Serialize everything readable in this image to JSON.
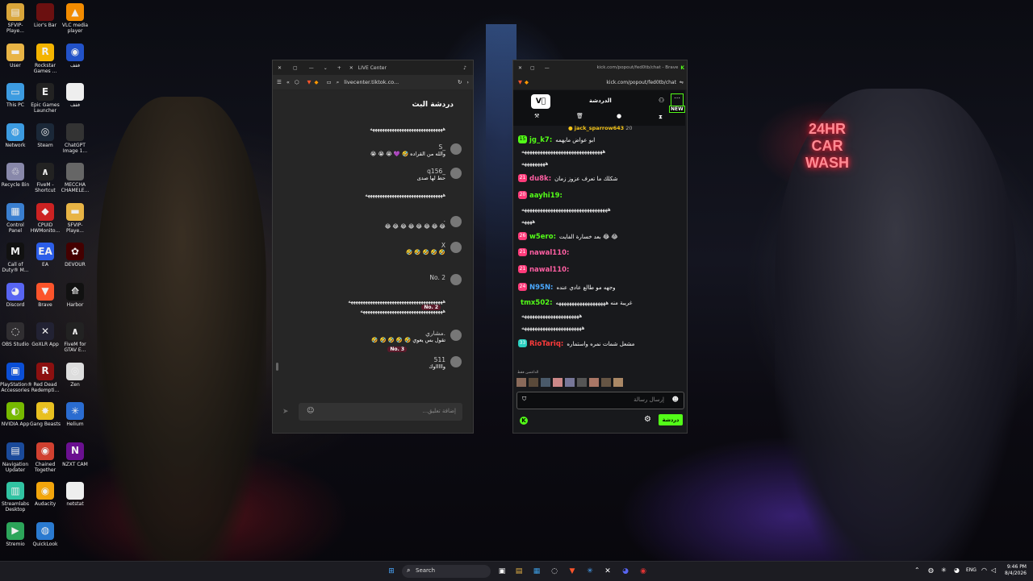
{
  "desktop_icons": [
    {
      "label": "SFVIP-Playe...",
      "color": "#d9a53a",
      "glyph": "▤"
    },
    {
      "label": "Lior's Bar",
      "color": "#6b1010",
      "glyph": ""
    },
    {
      "label": "VLC media player",
      "color": "#f28b00",
      "glyph": "▲"
    },
    {
      "label": "User",
      "color": "#e8b445",
      "glyph": "▬"
    },
    {
      "label": "Rockstar Games ...",
      "color": "#f4b400",
      "glyph": "R"
    },
    {
      "label": "ففف",
      "color": "#2252c8",
      "glyph": "◉"
    },
    {
      "label": "This PC",
      "color": "#3c9be0",
      "glyph": "▭"
    },
    {
      "label": "Epic Games Launcher",
      "color": "#222",
      "glyph": "E"
    },
    {
      "label": "ففف",
      "color": "#eee",
      "glyph": "▶"
    },
    {
      "label": "Network",
      "color": "#3c9be0",
      "glyph": "◍"
    },
    {
      "label": "Steam",
      "color": "#1b2838",
      "glyph": "◎"
    },
    {
      "label": "ChatGPT Image 1...",
      "color": "#333",
      "glyph": ""
    },
    {
      "label": "Recycle Bin",
      "color": "#88a",
      "glyph": "♲"
    },
    {
      "label": "FiveM - Shortcut",
      "color": "#222",
      "glyph": "∧"
    },
    {
      "label": "MECCHA CHAMELE...",
      "color": "#666",
      "glyph": ""
    },
    {
      "label": "Control Panel",
      "color": "#3a7fd0",
      "glyph": "▦"
    },
    {
      "label": "CPUID HWMonito...",
      "color": "#c22",
      "glyph": "◆"
    },
    {
      "label": "SFVIP-Playe...",
      "color": "#e8b445",
      "glyph": "▬"
    },
    {
      "label": "Call of Duty® M...",
      "color": "#111",
      "glyph": "M"
    },
    {
      "label": "EA",
      "color": "#2c5ee8",
      "glyph": "EA"
    },
    {
      "label": "DEVOUR",
      "color": "#400",
      "glyph": "✿"
    },
    {
      "label": "Discord",
      "color": "#5865f2",
      "glyph": "◕"
    },
    {
      "label": "Brave",
      "color": "#fb542b",
      "glyph": "▼"
    },
    {
      "label": "Harbor",
      "color": "#111",
      "glyph": "⟰"
    },
    {
      "label": "OBS Studio",
      "color": "#302e31",
      "glyph": "◌"
    },
    {
      "label": "GoXLR App",
      "color": "#223",
      "glyph": "✕"
    },
    {
      "label": "FiveM for GTAV E...",
      "color": "#222",
      "glyph": "∧"
    },
    {
      "label": "PlayStation® Accessories",
      "color": "#0b4fd6",
      "glyph": "▣"
    },
    {
      "label": "Red Dead Redempti...",
      "color": "#8c1010",
      "glyph": "R"
    },
    {
      "label": "Zen",
      "color": "#ddd",
      "glyph": "◎"
    },
    {
      "label": "NVIDIA App",
      "color": "#76b900",
      "glyph": "◐"
    },
    {
      "label": "Gang Beasts",
      "color": "#e8c020",
      "glyph": "✸"
    },
    {
      "label": "Helium",
      "color": "#2a6cd0",
      "glyph": "✳"
    },
    {
      "label": "Navigation Updater",
      "color": "#1a4a9a",
      "glyph": "▤"
    },
    {
      "label": "Chained Together",
      "color": "#d04030",
      "glyph": "◉"
    },
    {
      "label": "NZXT CAM",
      "color": "#6a1090",
      "glyph": "N"
    },
    {
      "label": "Streamlabs Desktop",
      "color": "#31c3a2",
      "glyph": "▥"
    },
    {
      "label": "Audacity",
      "color": "#f2a50c",
      "glyph": "◉"
    },
    {
      "label": "netstat",
      "color": "#eee",
      "glyph": "▯"
    },
    {
      "label": "Stremio",
      "color": "#2ca55a",
      "glyph": "▶"
    },
    {
      "label": "QuickLook",
      "color": "#2a7ad0",
      "glyph": "◍"
    }
  ],
  "neon_sign": {
    "line1": "24HR",
    "line2": "CAR",
    "line3": "WASH"
  },
  "tiktok_window": {
    "tab_title": "LIVE Center",
    "url": "livecenter.tiktok.co...",
    "panel_title": "دردشة البث",
    "comment_placeholder": "إضافة تعليق...",
    "messages": [
      {
        "user": "",
        "text": "ههههههههههههههههههههههههههههههه"
      },
      {
        "user": "S_",
        "text": "والله من القراده 🤣 💜 😭 😭 😭"
      },
      {
        "user": "q156_",
        "text": "حط لها صدى"
      },
      {
        "user": "",
        "text": "ههههههههههههههههههههههههههههههههه"
      },
      {
        "user": ".",
        "text": "😂 😂 😂 😂 😂 😂 😂 😂"
      },
      {
        "user": "X",
        "text": "🤣 🤣 🤣 🤣 🤣"
      },
      {
        "user": "No. 2",
        "text": ""
      },
      {
        "user": "",
        "text": "هههههههههههههههههههههههههههههههههههههههه"
      },
      {
        "user": "",
        "text": "ههههههههههههههههههههههههههههههههههه"
      },
      {
        "user": "مشاري.",
        "text": "تقول بس يعوي 🤣 🤣 🤣 🤣 🤣"
      },
      {
        "user": "511",
        "text": "واااااوك"
      }
    ],
    "badges": {
      "no2": "No. 2",
      "no3": "No. 3"
    }
  },
  "kick_window": {
    "window_title": "kick.com/popout/fed0tb/chat - Brave",
    "url": "kick.com/popout/fed0tb/chat",
    "header_title": "الدردشة",
    "new_badge": "NEW",
    "pinned_user": "jack_sparrow643",
    "pinned_count": "20",
    "input_placeholder": "إرسال رسالة",
    "send_label": "دردشة",
    "supporters_label": "الداعمين فقط",
    "messages": [
      {
        "badge": "15",
        "user": "jg_k7:",
        "text": "ابو عواض مايهمه",
        "user_color": "#53fc18"
      },
      {
        "badge": "",
        "user": "",
        "text": "هههههههههههههههههههههههههههههههه",
        "user_color": "#fff"
      },
      {
        "badge": "",
        "user": "",
        "text": "هههههههههه",
        "user_color": "#fff"
      },
      {
        "badge": "21",
        "user": "du8k:",
        "text": "شكلك ما تعرف عزوز زمان",
        "user_color": "#ff5fa2"
      },
      {
        "badge": "20",
        "user": "aayhi19:",
        "text": "",
        "user_color": "#53fc18"
      },
      {
        "badge": "",
        "user": "",
        "text": "هههههههههههههههههههههههههههههههههه",
        "user_color": "#fff"
      },
      {
        "badge": "",
        "user": "",
        "text": "ههههه",
        "user_color": "#fff"
      },
      {
        "badge": "26",
        "user": "w5ero:",
        "text": "بعد خسارة الفايت 😂 😂",
        "user_color": "#53fc18"
      },
      {
        "badge": "21",
        "user": "nawal110:",
        "text": "",
        "user_color": "#ff5fa2"
      },
      {
        "badge": "21",
        "user": "nawal110:",
        "text": "",
        "user_color": "#ff5fa2"
      },
      {
        "badge": "24",
        "user": "N95N:",
        "text": "وجهه مو طالع عادي عنده",
        "user_color": "#4aa8ff"
      },
      {
        "badge": "",
        "user": "tmx502:",
        "text": "غريبة منه هههههههههههههههههههه",
        "user_color": "#53fc18"
      },
      {
        "badge": "",
        "user": "",
        "text": "ههههههههههههههههههههههه",
        "user_color": "#fff"
      },
      {
        "badge": "",
        "user": "",
        "text": "هههههههههههههههههههههههه",
        "user_color": "#fff"
      },
      {
        "badge": "33",
        "user": "RioTariq:",
        "text": "مشعل شمات نمره واستماره",
        "user_color": "#ff3b3b"
      }
    ]
  },
  "taskbar": {
    "search_placeholder": "Search",
    "language": "ENG",
    "time": "9:46 PM",
    "date": "8/4/2026"
  },
  "colors": {
    "kick_green": "#53fc18",
    "tiktok_bg": "#242424",
    "kick_bg": "#18191c"
  }
}
